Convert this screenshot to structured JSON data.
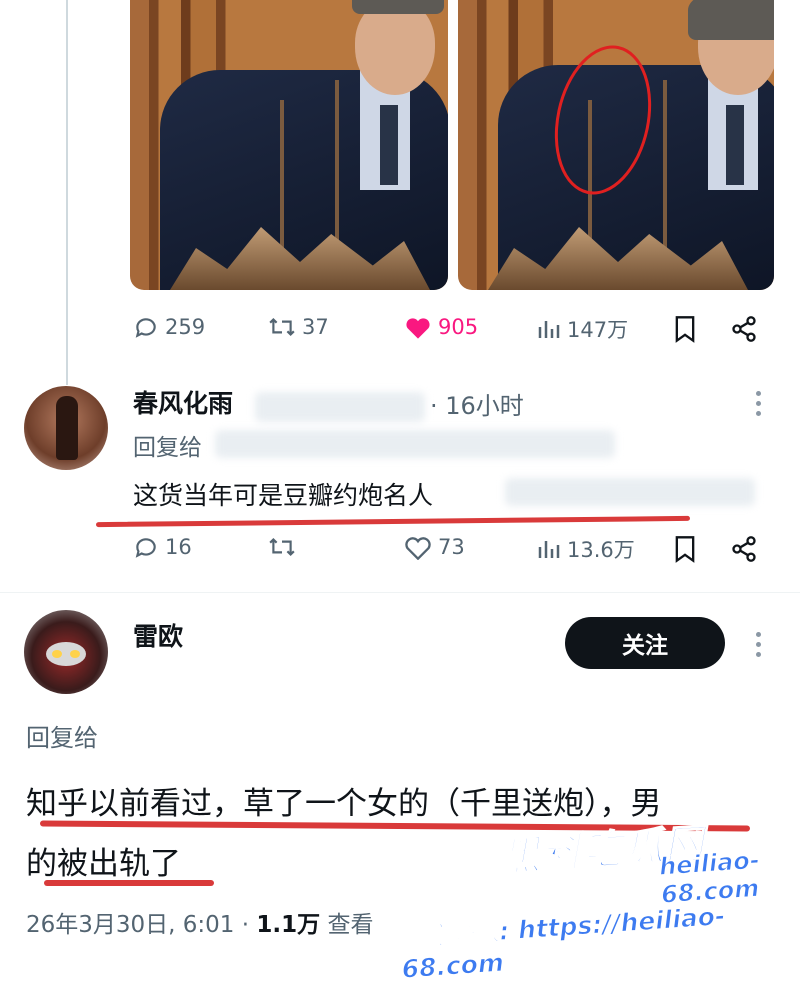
{
  "tweet": {
    "actions": {
      "replies": "259",
      "retweets": "37",
      "likes": "905",
      "views": "147万"
    },
    "colors": {
      "like_active": "#f91880"
    }
  },
  "reply1": {
    "name": "春风化雨",
    "time": "· 16小时",
    "reply_to": "回复给",
    "text": "这货当年可是豆瓣约炮名人",
    "actions": {
      "replies": "16",
      "likes": "73",
      "views": "13.6万"
    }
  },
  "reply2": {
    "name": "雷欧",
    "follow_label": "关注",
    "reply_to": "回复给",
    "text_line1": "知乎以前看过，草了一个女的（千里送炮），男",
    "text_line2": "的被出轨了",
    "meta_date": "26年3月30日, 6:01 ·",
    "meta_views": "1.1万",
    "meta_views_suffix": "查看"
  },
  "watermark": {
    "brand": "黑料吃瓜网",
    "domain": "heiliao-68.com",
    "note": "看完整版: https://heiliao-68.com"
  },
  "icons": [
    "reply-icon",
    "retweet-icon",
    "like-icon",
    "views-icon",
    "bookmark-icon",
    "share-icon",
    "more-icon"
  ]
}
